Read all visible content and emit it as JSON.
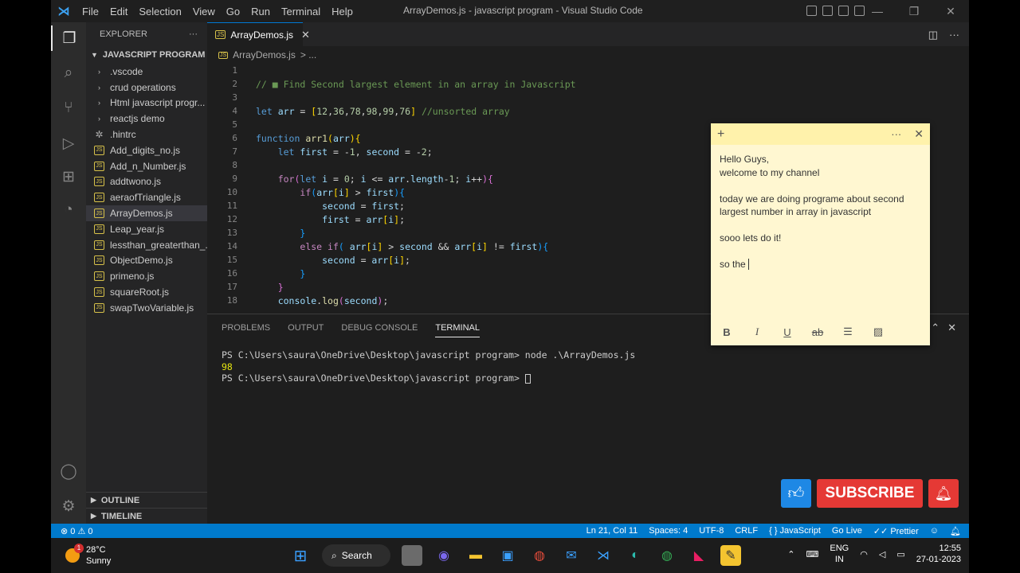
{
  "window": {
    "title": "ArrayDemos.js - javascript program - Visual Studio Code",
    "menu": [
      "File",
      "Edit",
      "Selection",
      "View",
      "Go",
      "Run",
      "Terminal",
      "Help"
    ],
    "minimize": "—",
    "restore": "❐",
    "close": "✕"
  },
  "sidebar": {
    "title": "EXPLORER",
    "more": "···",
    "folder": "JAVASCRIPT PROGRAM",
    "items": [
      {
        "label": ".vscode",
        "icon": "folder-icon"
      },
      {
        "label": "crud operations",
        "icon": "folder-icon"
      },
      {
        "label": "Html javascript progr...",
        "icon": "folder-icon"
      },
      {
        "label": "reactjs demo",
        "icon": "folder-icon"
      },
      {
        "label": ".hintrc",
        "icon": "config-icon"
      },
      {
        "label": "Add_digits_no.js",
        "icon": "js-icon"
      },
      {
        "label": "Add_n_Number.js",
        "icon": "js-icon"
      },
      {
        "label": "addtwono.js",
        "icon": "js-icon"
      },
      {
        "label": "aeraofTriangle.js",
        "icon": "js-icon"
      },
      {
        "label": "ArrayDemos.js",
        "icon": "js-icon"
      },
      {
        "label": "Leap_year.js",
        "icon": "js-icon"
      },
      {
        "label": "lessthan_greaterthan_...",
        "icon": "js-icon"
      },
      {
        "label": "ObjectDemo.js",
        "icon": "js-icon"
      },
      {
        "label": "primeno.js",
        "icon": "js-icon"
      },
      {
        "label": "squareRoot.js",
        "icon": "js-icon"
      },
      {
        "label": "swapTwoVariable.js",
        "icon": "js-icon"
      }
    ],
    "outline": "OUTLINE",
    "timeline": "TIMELINE"
  },
  "editor": {
    "tab_label": "ArrayDemos.js",
    "tab_close": "✕",
    "breadcrumb_file": "ArrayDemos.js",
    "breadcrumb_more": "> ...",
    "line_numbers": [
      "1",
      "2",
      "3",
      "4",
      "5",
      "6",
      "7",
      "8",
      "9",
      "10",
      "11",
      "12",
      "13",
      "14",
      "15",
      "16",
      "17",
      "18"
    ]
  },
  "panel": {
    "tabs": [
      "PROBLEMS",
      "OUTPUT",
      "DEBUG CONSOLE",
      "TERMINAL"
    ],
    "terminal_lines": [
      "PS C:\\Users\\saura\\OneDrive\\Desktop\\javascript program> node .\\ArrayDemos.js",
      "98",
      "PS C:\\Users\\saura\\OneDrive\\Desktop\\javascript program> "
    ]
  },
  "status": {
    "problems": "⊗ 0 ⚠ 0",
    "position": "Ln 21, Col 11",
    "spaces": "Spaces: 4",
    "encoding": "UTF-8",
    "eol": "CRLF",
    "language": "{ } JavaScript",
    "golive": "Go Live",
    "prettier": "✓✓ Prettier"
  },
  "note": {
    "add": "+",
    "more": "···",
    "close": "✕",
    "lines": [
      "Hello Guys,",
      "welcome to my channel",
      "today we are doing programe about second largest number in array in javascript",
      "sooo lets do it!",
      "so the"
    ],
    "tools": [
      "B",
      "I",
      "U",
      "ab",
      "☰",
      "▨"
    ]
  },
  "overlay": {
    "subscribe": "SUBSCRIBE"
  },
  "taskbar": {
    "temp": "28°C",
    "condition": "Sunny",
    "badge": "1",
    "search": "Search",
    "lang": "ENG",
    "region": "IN",
    "time": "12:55",
    "date": "27-01-2023"
  },
  "colors": {
    "statusbar": "#007acc",
    "note_bg": "#fff7d1",
    "subscribe": "#e53935",
    "like": "#1e88e5"
  }
}
